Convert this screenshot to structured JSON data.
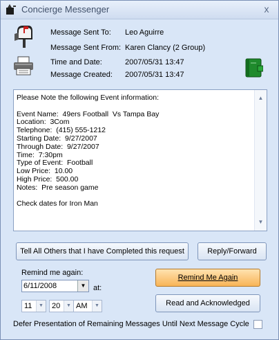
{
  "window": {
    "title": "Concierge Messenger",
    "close_glyph": "x"
  },
  "header": {
    "sent_to_label": "Message Sent To:",
    "sent_to_value": "Leo Aguirre",
    "sent_from_label": "Message Sent From:",
    "sent_from_value": "Karen Clancy  (2 Group)",
    "time_label": "Time and Date:",
    "time_value": "2007/05/31 13:47",
    "created_label": "Message Created:",
    "created_value": "2007/05/31 13:47"
  },
  "icons": {
    "mailbox": "mailbox-icon",
    "printer": "printer-icon",
    "book": "book-icon",
    "app": "app-icon",
    "scroll_up": "▲",
    "scroll_down": "▼"
  },
  "message": {
    "body": "Please Note the following Event information:\n\nEvent Name:  49ers Football  Vs Tampa Bay\nLocation:  3Com\nTelephone:  (415) 555-1212\nStarting Date:  9/27/2007\nThrough Date:  9/27/2007\nTime:  7:30pm\nType of Event:  Football\nLow Price:  10.00\nHigh Price:  500.00\nNotes:  Pre season game\n\nCheck dates for Iron Man"
  },
  "actions": {
    "tell_all_label": "Tell All Others that I have Completed this request",
    "reply_forward_label": "Reply/Forward",
    "remind_again_label": "Remind Me Again",
    "read_ack_label": "Read and Acknowledged"
  },
  "remind": {
    "label": "Remind me again:",
    "date": "6/11/2008",
    "at_label": "at:",
    "hour": "11",
    "minute": "20",
    "ampm": "AM",
    "dropdown_glyph": "▼"
  },
  "defer": {
    "label": "Defer Presentation of Remaining Messages Until Next Message Cycle",
    "checked": false
  },
  "colors": {
    "accent_orange": "#f8b457",
    "panel_blue": "#d9e6f7"
  }
}
